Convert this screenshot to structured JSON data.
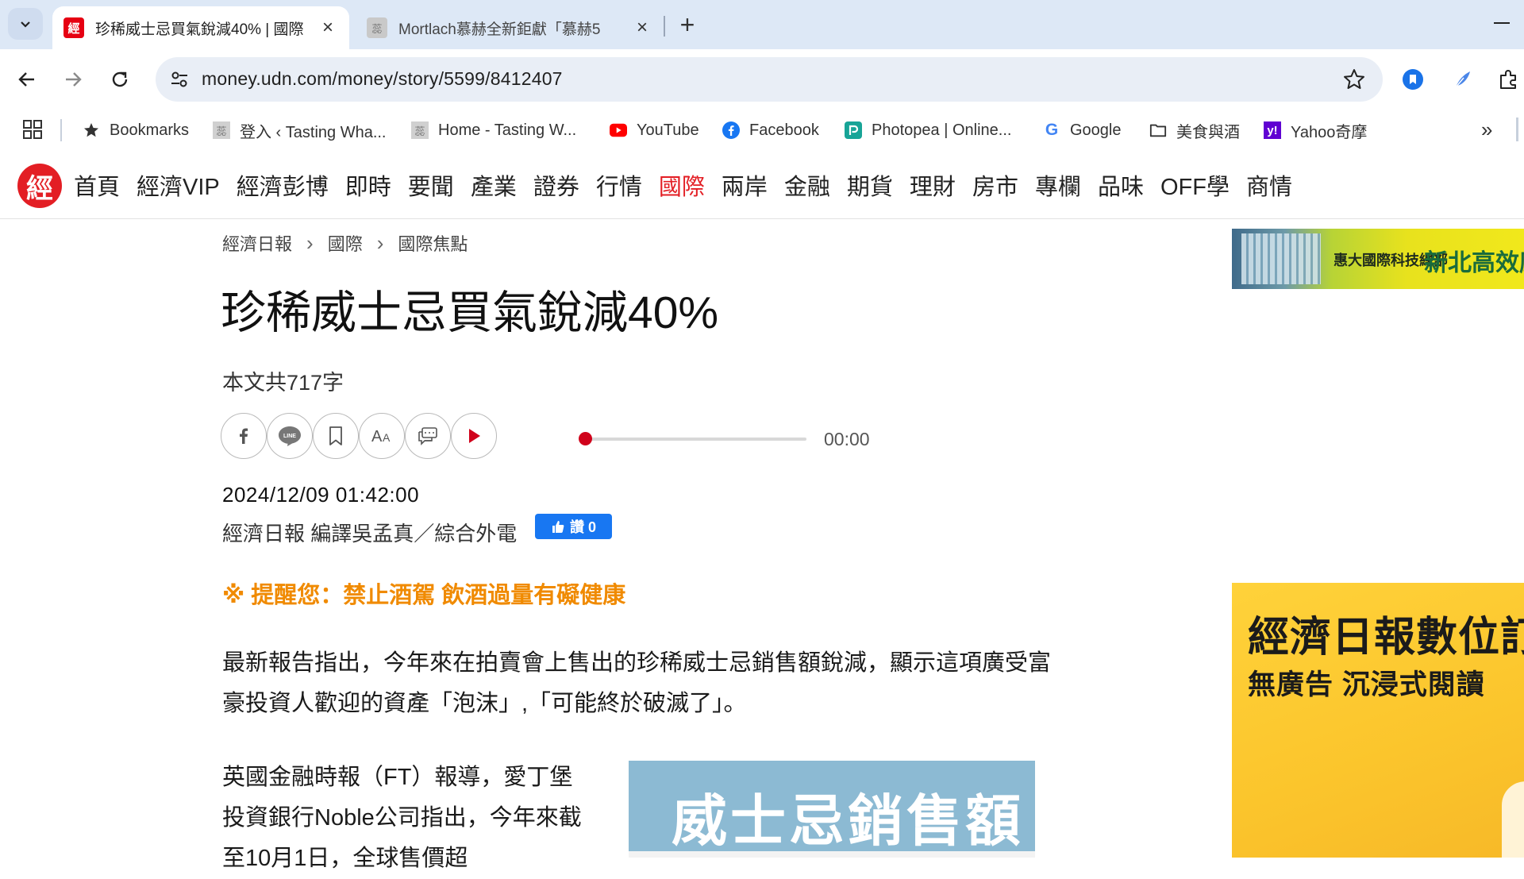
{
  "browser": {
    "tabs": [
      {
        "title": "珍稀威士忌買氣銳減40% | 國際",
        "favicon": "udn-logo",
        "active": true
      },
      {
        "title": "Mortlach慕赫全新鉅獻「慕赫5",
        "favicon": "tasting-logo",
        "active": false
      }
    ],
    "url": "money.udn.com/money/story/5599/8412407",
    "bookmarks": [
      {
        "label": "Bookmarks",
        "icon": "star-icon"
      },
      {
        "label": "登入 ‹ Tasting Wha...",
        "icon": "tasting-logo"
      },
      {
        "label": "Home - Tasting W...",
        "icon": "tasting-logo"
      },
      {
        "label": "YouTube",
        "icon": "youtube-icon"
      },
      {
        "label": "Facebook",
        "icon": "facebook-icon"
      },
      {
        "label": "Photopea | Online...",
        "icon": "photopea-icon"
      },
      {
        "label": "Google",
        "icon": "google-icon"
      },
      {
        "label": "美食與酒",
        "icon": "folder-icon"
      },
      {
        "label": "Yahoo奇摩",
        "icon": "yahoo-icon"
      }
    ]
  },
  "site": {
    "logo_text": "經",
    "nav": [
      "首頁",
      "經濟VIP",
      "經濟彭博",
      "即時",
      "要聞",
      "產業",
      "證券",
      "行情",
      "國際",
      "兩岸",
      "金融",
      "期貨",
      "理財",
      "房市",
      "專欄",
      "品味",
      "OFF學",
      "商情"
    ],
    "active_nav": "國際",
    "accent_color": "#e31e24"
  },
  "article": {
    "breadcrumbs": [
      "經濟日報",
      "國際",
      "國際焦點"
    ],
    "title": "珍稀威士忌買氣銳減40%",
    "word_count": "本文共717字",
    "share_icons": [
      "facebook-icon",
      "line-icon",
      "bookmark-icon",
      "font-size-icon",
      "comment-icon",
      "play-icon"
    ],
    "audio_time": "00:00",
    "audio_progress": 0,
    "datetime": "2024/12/09 01:42:00",
    "author": "經濟日報 編譯吳孟真／綜合外電",
    "like_label": "讚 0",
    "warning": "※ 提醒您：禁止酒駕 飲酒過量有礙健康",
    "paragraph1": "最新報告指出，今年來在拍賣會上售出的珍稀威士忌銷售額銳減，顯示這項廣受富豪投資人歡迎的資產「泡沫」,「可能終於破滅了」。",
    "paragraph2": "英國金融時報（FT）報導，愛丁堡投資銀行Noble公司指出，今年來截至10月1日，全球售價超",
    "image_caption": "威士忌銷售額"
  },
  "ads": {
    "banner_company": "惠大國際科技總部",
    "banner_slogan": "新北高效廊",
    "digital_title": "經濟日報數位訂",
    "digital_sub": "無廣告  沉浸式閱讀"
  }
}
